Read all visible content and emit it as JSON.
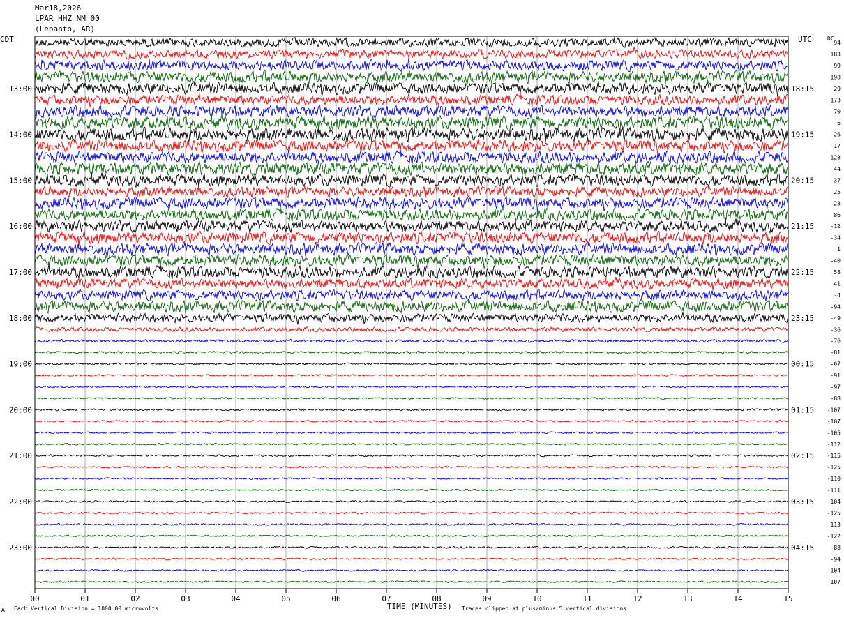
{
  "header": {
    "date": "Mar18,2026",
    "station": "LPAR HHZ NM 00",
    "location": "(Lepanto, AR)",
    "left_zone": "CDT",
    "right_zone": "UTC",
    "dc_label": "DC"
  },
  "footer": {
    "scale_note": "Each Vertical Division = 1000.00 microvolts",
    "xlabel": "TIME (MINUTES)",
    "clip_note": "Traces clipped at plus/minus 5 vertical divisions",
    "corner_mark": "A"
  },
  "chart_data": {
    "type": "line",
    "title": "LPAR HHZ NM 00 (Lepanto, AR)",
    "xlabel": "TIME (MINUTES)",
    "ylabel": "",
    "xlim": [
      0,
      15
    ],
    "x_ticks": [
      "00",
      "01",
      "02",
      "03",
      "04",
      "05",
      "06",
      "07",
      "08",
      "09",
      "10",
      "11",
      "12",
      "13",
      "14",
      "15"
    ],
    "trace_count": 48,
    "trace_interval_minutes": 15,
    "trace_colors": [
      "#000000",
      "#ff0000",
      "#0000ff",
      "#006600"
    ],
    "left_hour_labels": [
      "13:00",
      "14:00",
      "15:00",
      "16:00",
      "17:00",
      "18:00",
      "19:00",
      "20:00",
      "21:00",
      "22:00",
      "23:00"
    ],
    "right_hour_labels": [
      "18:15",
      "19:15",
      "20:15",
      "21:15",
      "22:15",
      "23:15",
      "00:15",
      "01:15",
      "02:15",
      "03:15",
      "04:15"
    ],
    "hour_label_first_trace": 4,
    "dc_offsets": [
      94,
      183,
      99,
      198,
      29,
      173,
      70,
      6,
      -26,
      17,
      128,
      44,
      37,
      25,
      -23,
      86,
      -12,
      -34,
      1,
      -40,
      58,
      41,
      -4,
      -94,
      -49,
      -36,
      -76,
      -81,
      -67,
      -91,
      -97,
      -88,
      -107,
      -107,
      -105,
      -112,
      -115,
      -125,
      -110,
      -111,
      -104,
      -125,
      -113,
      -122,
      -88,
      -94,
      -104,
      -107
    ],
    "noise_amplitude": [
      6,
      6,
      7,
      8,
      8,
      7,
      8,
      9,
      9,
      8,
      8,
      9,
      8,
      7,
      8,
      8,
      8,
      8,
      8,
      8,
      8,
      7,
      7,
      8,
      6,
      3,
      2,
      1.5,
      1.3,
      1.2,
      1.2,
      1.2,
      1.3,
      1.2,
      1.2,
      1.2,
      1.3,
      1.2,
      1.2,
      1.2,
      1.3,
      1.2,
      1.3,
      1.2,
      1.3,
      1.2,
      1.2,
      1.2
    ],
    "clip_divisions": 5,
    "vertical_division_microvolts": 1000
  }
}
